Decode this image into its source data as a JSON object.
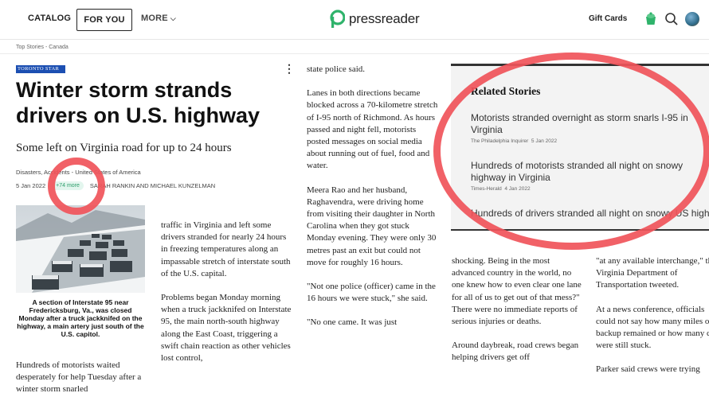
{
  "nav": {
    "catalog": "CATALOG",
    "for_you": "FOR YOU",
    "more": "MORE",
    "brand": "pressreader",
    "gift_cards": "Gift Cards"
  },
  "breadcrumb": "Top Stories - Canada",
  "article": {
    "source": "TORONTO STAR",
    "headline": "Winter storm strands drivers on U.S. highway",
    "subhead": "Some left on Virginia road for up to 24 hours",
    "tags": "Disasters, Accidents - United States of America",
    "date": "5 Jan 2022",
    "more_badge": "+74 more",
    "authors": "SARAH RANKIN AND MICHAEL KUNZELMAN",
    "caption": "A section of Interstate 95 near Fredericksburg, Va., was closed Monday after a truck jackknifed on the highway, a main artery just south of the U.S. capitol.",
    "col_a": [
      "Hundreds of motorists waited desperately for help Tuesday after a winter storm snarled"
    ],
    "col_b": [
      "traffic in Virginia and left some drivers stranded for nearly 24 hours in freezing temperatures along an impassable stretch of interstate south of the U.S. capital.",
      "Problems began Monday morning when a truck jackknifed on Interstate 95, the main north-south highway along the East Coast, triggering a swift chain reaction as other vehicles lost control,"
    ],
    "col_c": [
      "state police said.",
      "Lanes in both directions became blocked across a 70-kilometre stretch of I-95 north of Richmond. As hours passed and night fell, motorists posted messages on social media about running out of fuel, food and water.",
      "Meera Rao and her husband, Raghavendra, were driving home from visiting their daughter in North Carolina when they got stuck Monday evening. They were only 30 metres past an exit but could not move for roughly 16 hours.",
      "\"Not one police (officer) came in the 16 hours we were stuck,\" she said.",
      "\"No one came. It was just"
    ],
    "col_d": [
      "shocking. Being in the most advanced country in the world, no one knew how to even clear one lane for all of us to get out of that mess?\" There were no immediate reports of serious injuries or deaths.",
      "Around daybreak, road crews began helping drivers get off"
    ],
    "col_e": [
      "\"at any available interchange,\" the Virginia Department of Transportation tweeted.",
      "At a news conference, officials could not say how many miles of backup remained or how many cars were still stuck.",
      "Parker said crews were trying"
    ]
  },
  "related": {
    "title": "Related Stories",
    "items": [
      {
        "headline": "Motorists stranded overnight as storm snarls I-95 in Virginia",
        "source": "The Philadelphia Inquirer",
        "date": "5 Jan 2022"
      },
      {
        "headline": "Hundreds of motorists stranded all night on snowy highway in Virginia",
        "source": "Times-Herald",
        "date": "4 Jan 2022"
      },
      {
        "headline": "Hundreds of drivers stranded all night on snowy US highway",
        "source": "",
        "date": ""
      }
    ]
  },
  "colors": {
    "accent_red": "#f0545a",
    "brand_green": "#2fb36b",
    "source_blue": "#1c4fb2"
  }
}
